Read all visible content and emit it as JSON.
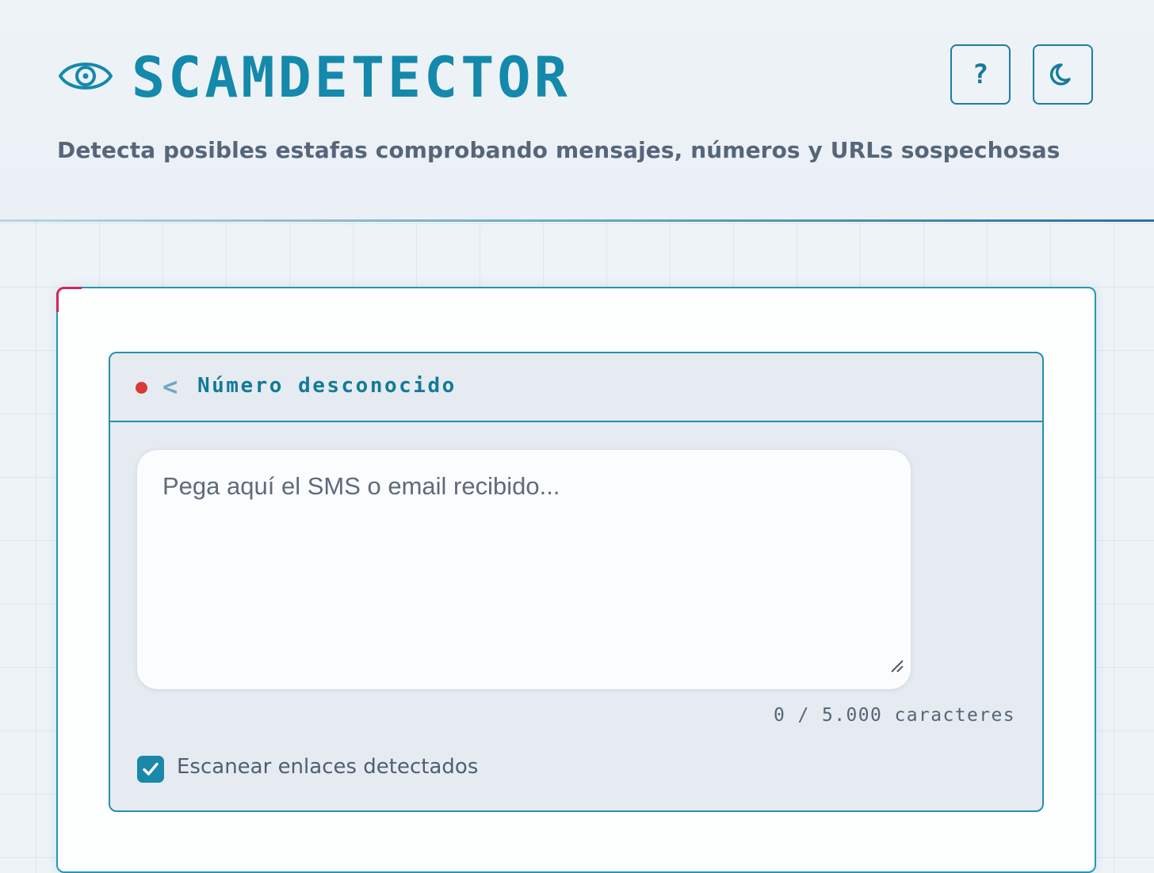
{
  "header": {
    "brand": "SCAMDETECTOR",
    "subtitle": "Detecta posibles estafas comprobando mensajes, números y URLs sospechosas",
    "help_label": "?",
    "icons": {
      "logo": "eye-icon",
      "help": "question-mark-icon",
      "theme": "moon-icon"
    }
  },
  "chat": {
    "contact_name": "Número desconocido",
    "back_label": "<",
    "status_color": "#d93a35",
    "message_placeholder": "Pega aquí el SMS o email recibido...",
    "message_value": "",
    "char_count": "0 / 5.000 caracteres",
    "scan_links_label": "Escanear enlaces detectados",
    "scan_links_checked": true
  },
  "colors": {
    "accent": "#1489ab",
    "border": "#2590ae",
    "corner_accent": "#d3265f"
  }
}
